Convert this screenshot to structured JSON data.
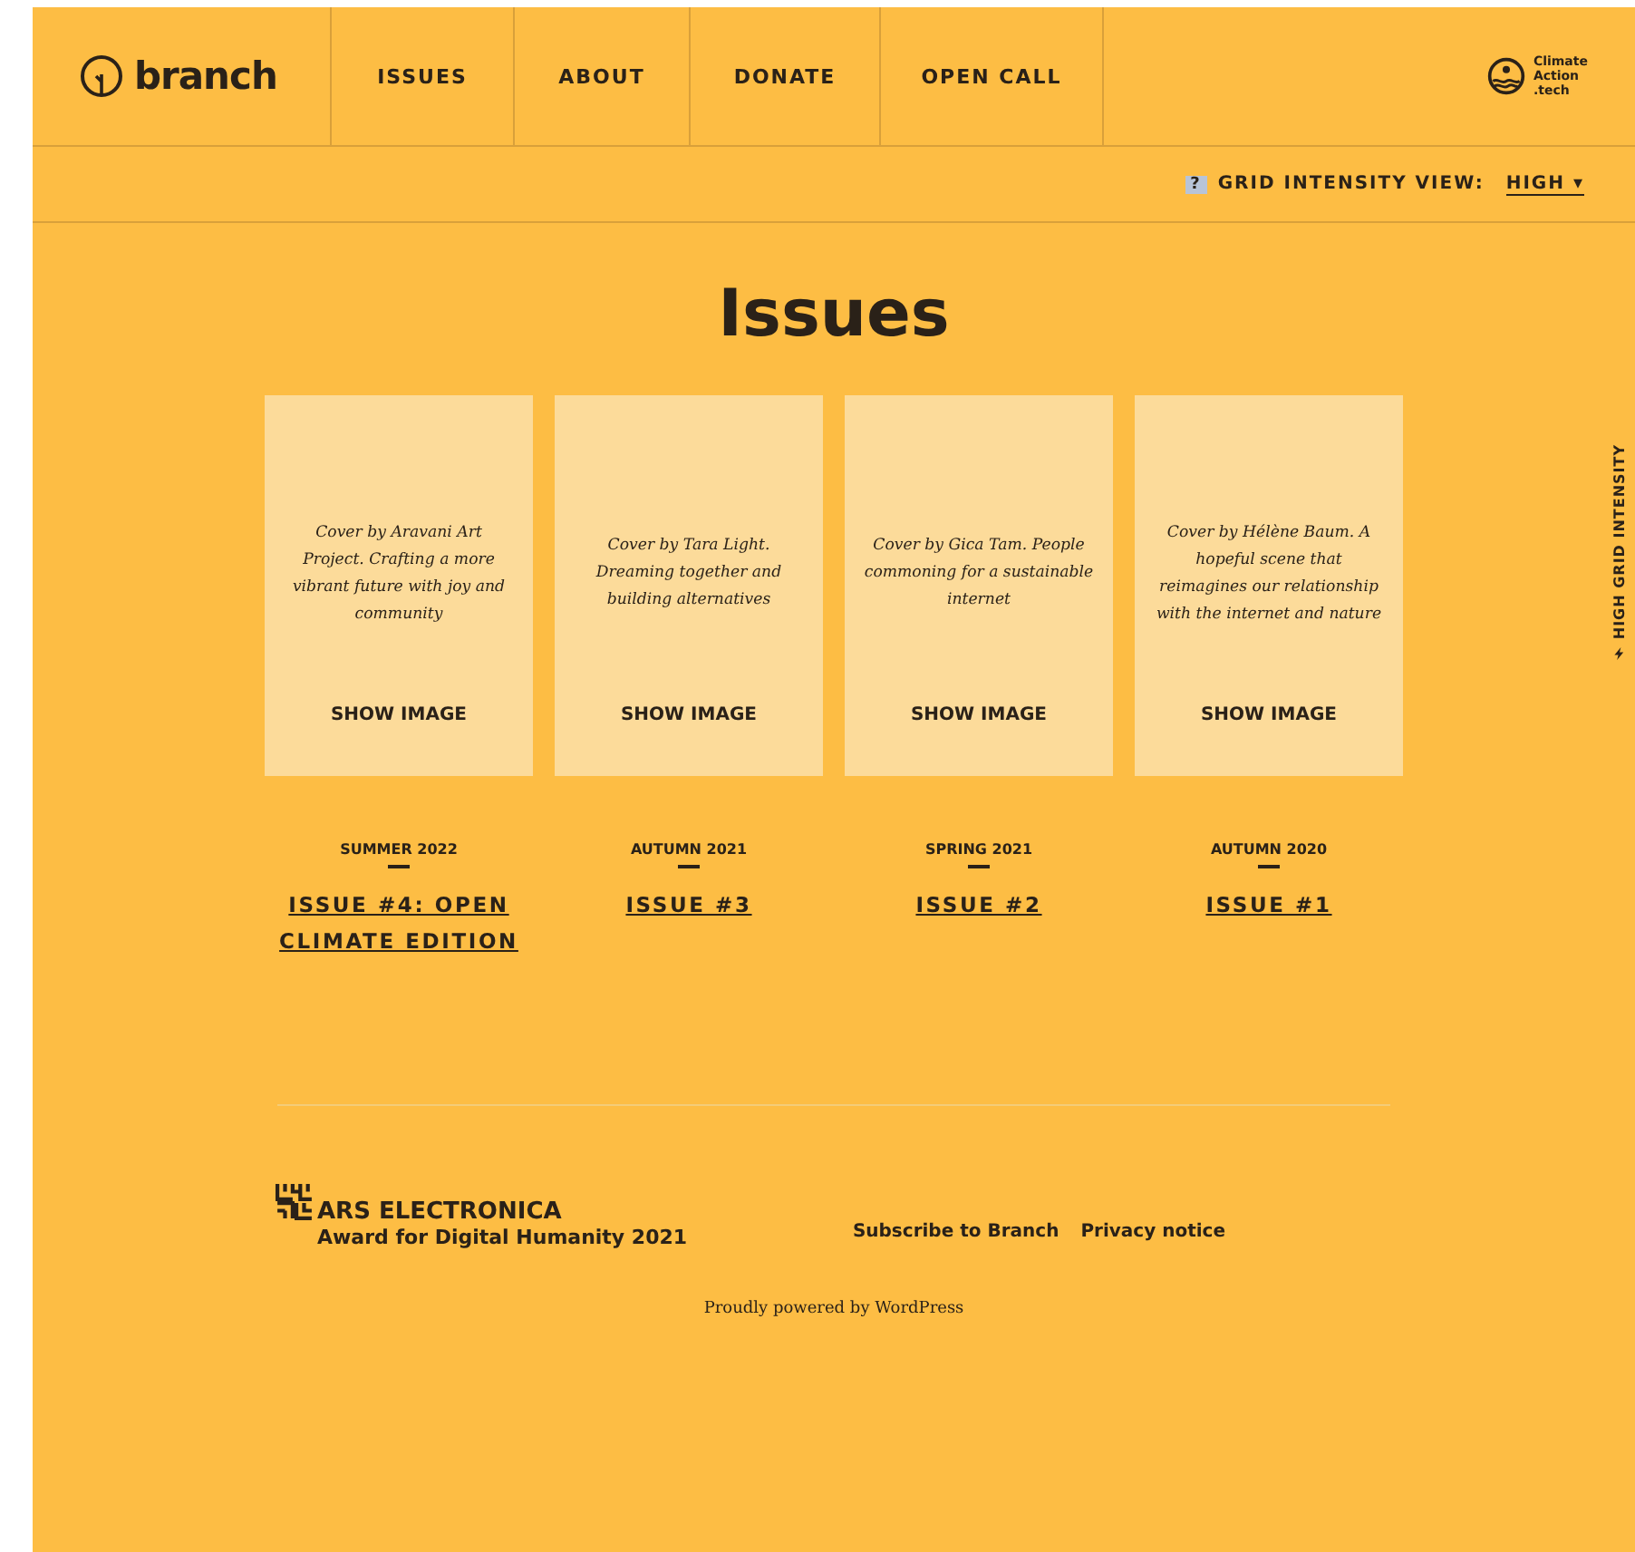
{
  "header": {
    "logo": "branch",
    "nav": [
      {
        "label": "ISSUES"
      },
      {
        "label": "ABOUT"
      },
      {
        "label": "DONATE"
      },
      {
        "label": "OPEN CALL"
      }
    ],
    "partner_logo": [
      "Climate",
      "Action",
      ".tech"
    ]
  },
  "grid_bar": {
    "help": "?",
    "label": "GRID INTENSITY VIEW:",
    "value": "HIGH ▾"
  },
  "side_label": "HIGH GRID INTENSITY",
  "title": "Issues",
  "issues": [
    {
      "cover_text": "Cover by Aravani Art Project. Crafting a more vibrant future with joy and community",
      "button": "SHOW IMAGE",
      "season": "SUMMER 2022",
      "link": "ISSUE #4: OPEN CLIMATE EDITION"
    },
    {
      "cover_text": "Cover by Tara Light. Dreaming together and building alternatives",
      "button": "SHOW IMAGE",
      "season": "AUTUMN 2021",
      "link": "ISSUE #3"
    },
    {
      "cover_text": "Cover by Gica Tam. People commoning for a sustainable internet",
      "button": "SHOW IMAGE",
      "season": "SPRING 2021",
      "link": "ISSUE #2"
    },
    {
      "cover_text": "Cover by Hélène Baum. A hopeful scene that reimagines our relationship with the internet and nature",
      "button": "SHOW IMAGE",
      "season": "AUTUMN 2020",
      "link": "ISSUE #1"
    }
  ],
  "footer": {
    "award_title": "ARS ELECTRONICA",
    "award_subtitle": "Award for Digital Humanity 2021",
    "links": [
      "Subscribe to Branch",
      "Privacy notice"
    ],
    "powered": "Proudly powered by WordPress"
  }
}
